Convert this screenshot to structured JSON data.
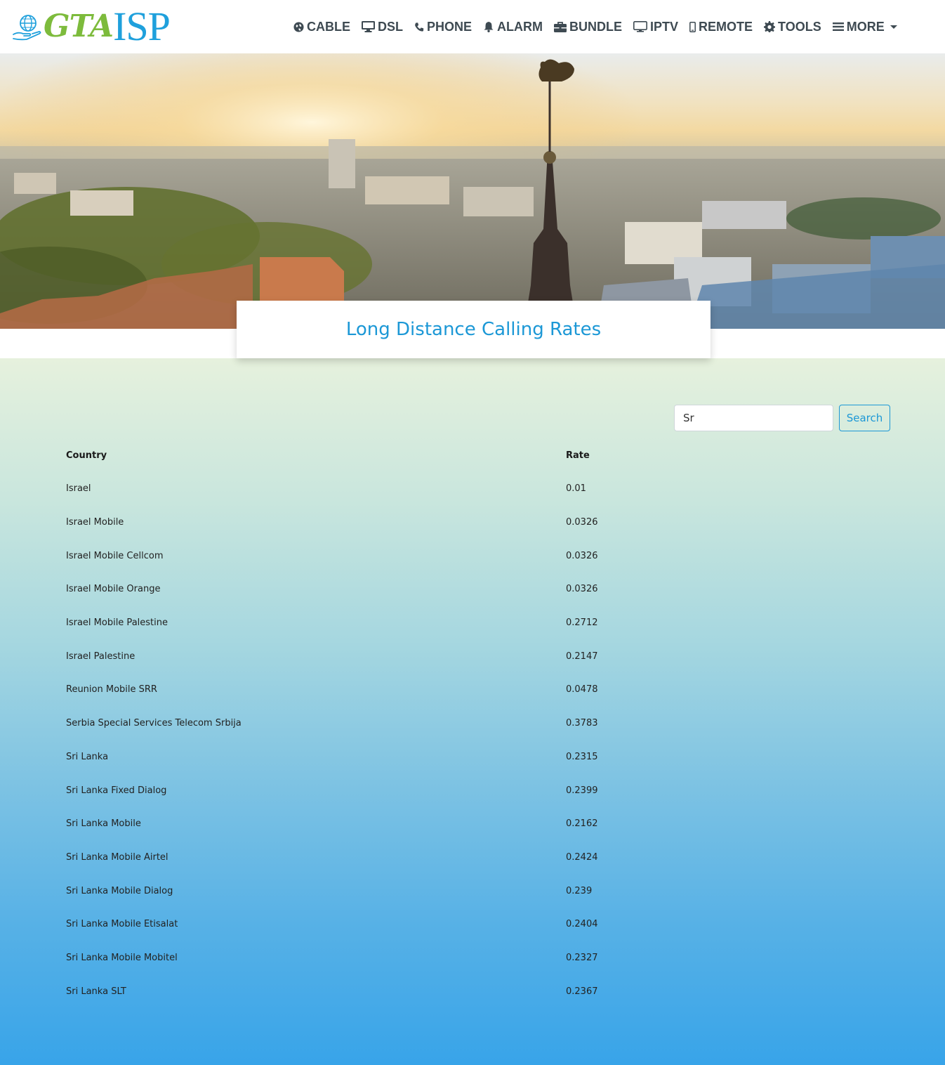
{
  "brand": {
    "part1": "GTA",
    "part2": "ISP"
  },
  "nav": [
    {
      "label": "CABLE",
      "icon": "globe-icon"
    },
    {
      "label": "DSL",
      "icon": "desktop-icon"
    },
    {
      "label": "PHONE",
      "icon": "phone-icon"
    },
    {
      "label": "ALARM",
      "icon": "bell-icon"
    },
    {
      "label": "BUNDLE",
      "icon": "briefcase-icon"
    },
    {
      "label": "IPTV",
      "icon": "tv-icon"
    },
    {
      "label": "REMOTE",
      "icon": "mobile-icon"
    },
    {
      "label": "TOOLS",
      "icon": "gear-icon"
    },
    {
      "label": "MORE",
      "icon": "menu-icon"
    }
  ],
  "page": {
    "title": "Long Distance Calling Rates"
  },
  "search": {
    "value": "Sr",
    "button_label": "Search"
  },
  "table": {
    "headers": {
      "country": "Country",
      "rate": "Rate"
    },
    "rows": [
      {
        "country": "Israel",
        "rate": "0.01"
      },
      {
        "country": "Israel Mobile",
        "rate": "0.0326"
      },
      {
        "country": "Israel Mobile Cellcom",
        "rate": "0.0326"
      },
      {
        "country": "Israel Mobile Orange",
        "rate": "0.0326"
      },
      {
        "country": "Israel Mobile Palestine",
        "rate": "0.2712"
      },
      {
        "country": "Israel Palestine",
        "rate": "0.2147"
      },
      {
        "country": "Reunion Mobile SRR",
        "rate": "0.0478"
      },
      {
        "country": "Serbia Special Services Telecom Srbija",
        "rate": "0.3783"
      },
      {
        "country": "Sri Lanka",
        "rate": "0.2315"
      },
      {
        "country": "Sri Lanka Fixed Dialog",
        "rate": "0.2399"
      },
      {
        "country": "Sri Lanka Mobile",
        "rate": "0.2162"
      },
      {
        "country": "Sri Lanka Mobile Airtel",
        "rate": "0.2424"
      },
      {
        "country": "Sri Lanka Mobile Dialog",
        "rate": "0.239"
      },
      {
        "country": "Sri Lanka Mobile Etisalat",
        "rate": "0.2404"
      },
      {
        "country": "Sri Lanka Mobile Mobitel",
        "rate": "0.2327"
      },
      {
        "country": "Sri Lanka SLT",
        "rate": "0.2367"
      }
    ]
  },
  "colors": {
    "brand_green": "#7dbb3c",
    "brand_blue": "#1fa0dc",
    "title_blue": "#1c98d6",
    "nav_text": "#3e4a52"
  }
}
